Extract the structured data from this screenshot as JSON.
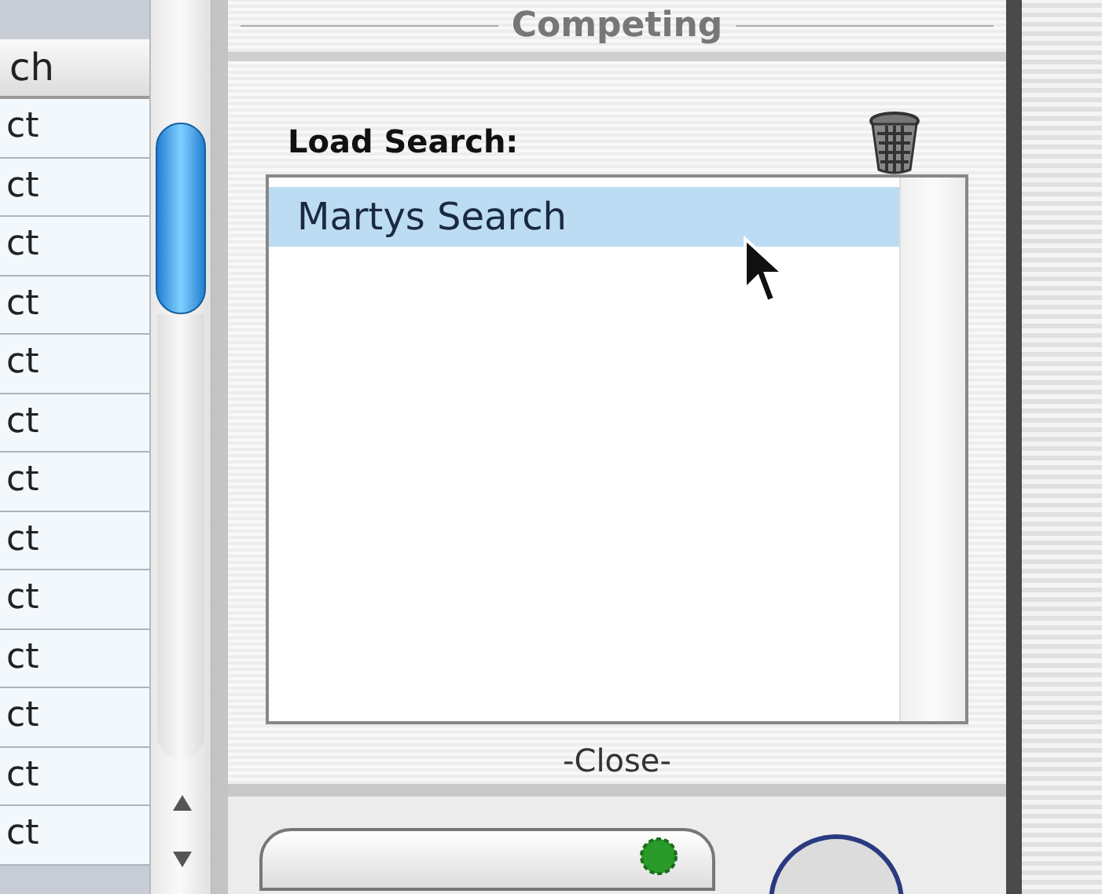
{
  "table": {
    "column_header": "ch",
    "rows": [
      "ct",
      "ct",
      "ct",
      "ct",
      "ct",
      "ct",
      "ct",
      "ct",
      "ct",
      "ct",
      "ct",
      "ct",
      "ct"
    ]
  },
  "panel": {
    "group_title": "Competing",
    "load_label": "Load Search:",
    "saved_searches": [
      {
        "name": "Martys Search",
        "selected": true
      }
    ],
    "close_link": "-Close-"
  }
}
